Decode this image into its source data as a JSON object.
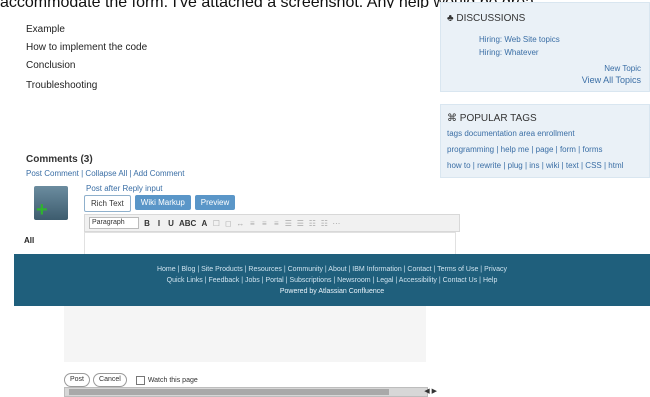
{
  "top_caption": "accommodate the form. I've attached a screenshot. Any help would be grea",
  "main": {
    "sections": [
      "Example",
      "How to implement the code",
      "Conclusion",
      "Troubleshooting"
    ],
    "comments_title": "Comments (3)",
    "comment_actions": "Post Comment | Collapse All | Add Comment",
    "editor_title": "Post after Reply input",
    "tabs": [
      "Rich Text",
      "Wiki Markup",
      "Preview"
    ],
    "toolbar": {
      "font_select": "Paragraph",
      "buttons": [
        "B",
        "I",
        "U",
        "ABC",
        "A",
        "☐",
        "◻",
        "↔",
        "≡",
        "≡",
        "≡",
        "☰",
        "☰",
        "☷",
        "☷",
        "⋯"
      ]
    },
    "side_label": "All"
  },
  "right": {
    "discussions": {
      "title": "DISCUSSIONS",
      "lines": [
        "Hiring: Web Site topics",
        "Hiring: Whatever"
      ],
      "new_topic": "New Topic",
      "view_all": "View All Topics"
    },
    "popular_tags": {
      "title": "POPULAR TAGS",
      "lines": [
        "tags documentation area enrollment",
        "programming | help me | page | form | forms",
        "how to | rewrite | plug | ins | wiki | text | CSS | html"
      ]
    }
  },
  "footer": {
    "line1": "Home  |  Blog  |  Site Products  |  Resources  |  Community  |  About  |  IBM Information  |  Contact  |  Terms of Use  |  Privacy",
    "line2": "Quick Links  |  Feedback  |  Jobs  |  Portal  |  Subscriptions  |  Newsroom  |  Legal  |  Accessibility  |  Contact Us  |  Help",
    "line3": "Powered by Atlassian Confluence"
  },
  "bottom": {
    "buttons": [
      "Post",
      "Cancel"
    ],
    "checkbox_label": "Watch this page"
  }
}
